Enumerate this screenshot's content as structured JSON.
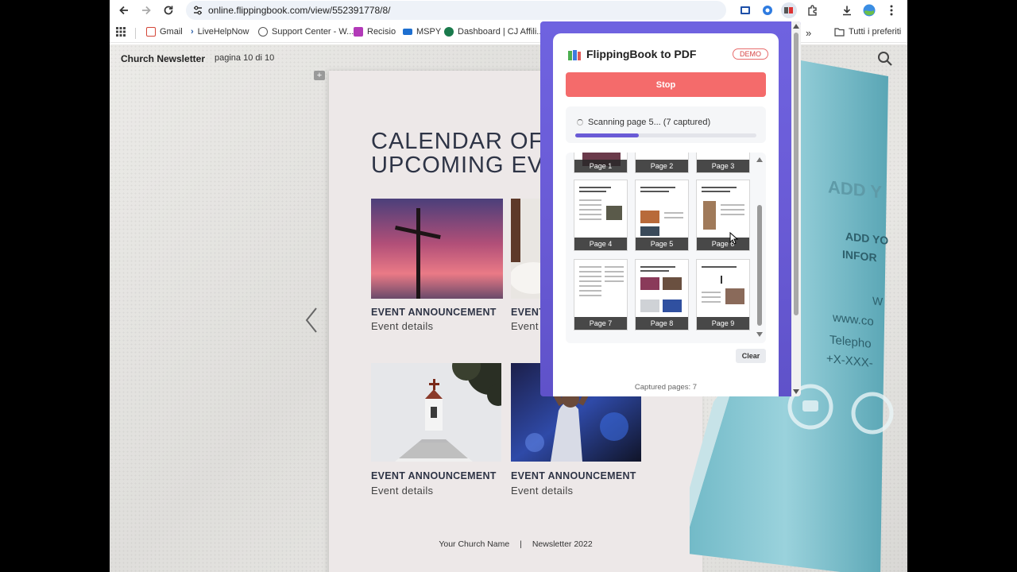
{
  "browser": {
    "url": "online.flippingbook.com/view/552391778/8/",
    "bookmarks": [
      "Gmail",
      "LiveHelpNow",
      "Support Center - W...",
      "Recisio",
      "MSPY",
      "Dashboard | CJ Affili..."
    ],
    "more_bookmarks": "»",
    "all_bookmarks": "Tutti i preferiti"
  },
  "viewer": {
    "doc_title": "Church Newsletter",
    "page_indicator": "pagina 10 di 10"
  },
  "newsletter": {
    "heading": "CALENDAR OF\nUPCOMING EV",
    "events": [
      {
        "title": "EVENT ANNOUNCEMENT",
        "details": "Event details"
      },
      {
        "title": "EVENT",
        "details": "Event"
      },
      {
        "title": "EVENT ANNOUNCEMENT",
        "details": "Event details"
      },
      {
        "title": "EVENT ANNOUNCEMENT",
        "details": "Event details"
      }
    ],
    "footer_church": "Your Church Name",
    "footer_sep": "|",
    "footer_year": "Newsletter 2022"
  },
  "brochure": {
    "line1": "ADD Y",
    "line2": "ADD YO",
    "line3": "INFOR",
    "line4": "W",
    "line5": "www.co",
    "line6": "Telepho",
    "line7": "+X-XXX-"
  },
  "popup": {
    "title": "FlippingBook to PDF",
    "badge": "DEMO",
    "stop_label": "Stop",
    "status": "Scanning page 5... (7 captured)",
    "progress": 0.35,
    "thumbnails": [
      "Page 1",
      "Page 2",
      "Page 3",
      "Page 4",
      "Page 5",
      "Page 6",
      "Page 7",
      "Page 8",
      "Page 9"
    ],
    "clear_label": "Clear",
    "captured_label": "Captured pages: 7"
  }
}
